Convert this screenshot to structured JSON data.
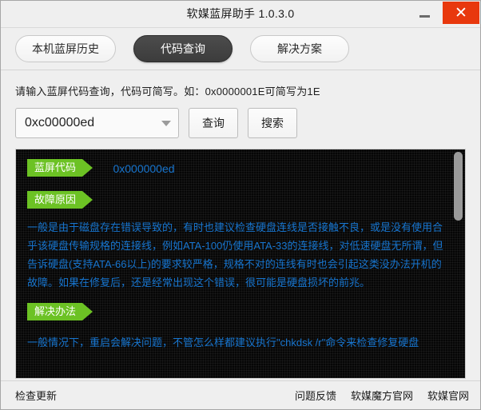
{
  "window": {
    "title": "软媒蓝屏助手 1.0.3.0",
    "minimize_label": "−",
    "close_label": "✕"
  },
  "tabs": [
    {
      "label": "本机蓝屏历史",
      "active": false
    },
    {
      "label": "代码查询",
      "active": true
    },
    {
      "label": "解决方案",
      "active": false
    }
  ],
  "search": {
    "hint": "请输入蓝屏代码查询，代码可简写。如：0x0000001E可简写为1E",
    "input_value": "0xc00000ed",
    "input_placeholder": "0x0000001E",
    "query_button": "查询",
    "search_button": "搜索"
  },
  "result": {
    "code_badge": "蓝屏代码",
    "code_value": "0x000000ed",
    "reason_badge": "故障原因",
    "reason_text": "一般是由于磁盘存在错误导致的，有时也建议检查硬盘连线是否接触不良，或是没有使用合乎该硬盘传输规格的连接线，例如ATA-100仍使用ATA-33的连接线，对低速硬盘无所谓，但告诉硬盘(支持ATA-66以上)的要求较严格，规格不对的连线有时也会引起这类没办法开机的故障。如果在修复后，还是经常出现这个错误，很可能是硬盘损坏的前兆。",
    "solution_badge": "解决办法",
    "solution_text": "一般情况下，重启会解决问题，不管怎么样都建议执行\"chkdsk /r\"命令来检查修复硬盘"
  },
  "statusbar": {
    "check_update": "检查更新",
    "links": [
      "问题反馈",
      "软媒魔方官网",
      "软媒官网"
    ]
  },
  "colors": {
    "accent_green": "#6cc224",
    "link_blue": "#1775cf",
    "close_red": "#e8380d",
    "panel_black": "#060606",
    "chrome_gray": "#efefef"
  }
}
